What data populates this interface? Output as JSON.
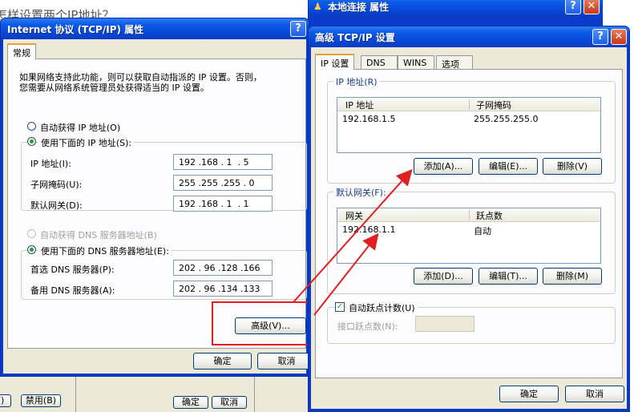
{
  "background": {
    "heading_fragment": "怎样设置两个IP地址？",
    "button_bottom_left": "禁用(B)",
    "button_bottom_left_partial": "F)",
    "button_ok": "确定",
    "button_cancel": "取消"
  },
  "local_conn_window": {
    "title": "本地连接 属性"
  },
  "tcpip_window": {
    "title": "Internet 协议 (TCP/IP) 属性",
    "tab_general": "常规",
    "intro_line1": "如果网络支持此功能，则可以获取自动指派的 IP 设置。否则，",
    "intro_line2": "您需要从网络系统管理员处获得适当的 IP 设置。",
    "radio_auto_ip": "自动获得 IP 地址(O)",
    "radio_manual_ip": "使用下面的 IP 地址(S):",
    "label_ip": "IP 地址(I):",
    "label_mask": "子网掩码(U):",
    "label_gateway": "默认网关(D):",
    "ip": "192 .168 . 1  . 5",
    "mask": "255 .255 .255 . 0",
    "gateway": "192 .168 . 1  . 1",
    "radio_auto_dns": "自动获得 DNS 服务器地址(B)",
    "radio_manual_dns": "使用下面的 DNS 服务器地址(E):",
    "label_dns1": "首选 DNS 服务器(P):",
    "label_dns2": "备用 DNS 服务器(A):",
    "dns1": "202 . 96 .128 .166",
    "dns2": "202 . 96 .134 .133",
    "advanced_button": "高级(V)...",
    "ok_button": "确定",
    "cancel_button": "取消"
  },
  "advanced_window": {
    "title": "高级 TCP/IP 设置",
    "tabs": [
      "IP 设置",
      "DNS",
      "WINS",
      "选项"
    ],
    "ip_group_label": "IP 地址(R)",
    "ip_list_headers": [
      "IP 地址",
      "子网掩码"
    ],
    "ip_list_rows": [
      {
        "ip": "192.168.1.5",
        "mask": "255.255.255.0"
      }
    ],
    "ip_buttons": [
      "添加(A)...",
      "编辑(E)...",
      "删除(V)"
    ],
    "gw_group_label": "默认网关(F):",
    "gw_list_headers": [
      "网关",
      "跃点数"
    ],
    "gw_list_rows": [
      {
        "gateway": "192.168.1.1",
        "metric": "自动"
      }
    ],
    "gw_buttons": [
      "添加(D)...",
      "编辑(T)...",
      "删除(M)"
    ],
    "auto_metric_label": "自动跃点计数(U)",
    "interface_metric_label": "接口跃点数(N):",
    "ok_button": "确定",
    "cancel_button": "取消"
  },
  "colors": {
    "annotation_red": "#e02020",
    "title_blue": "#0a5ae6"
  }
}
